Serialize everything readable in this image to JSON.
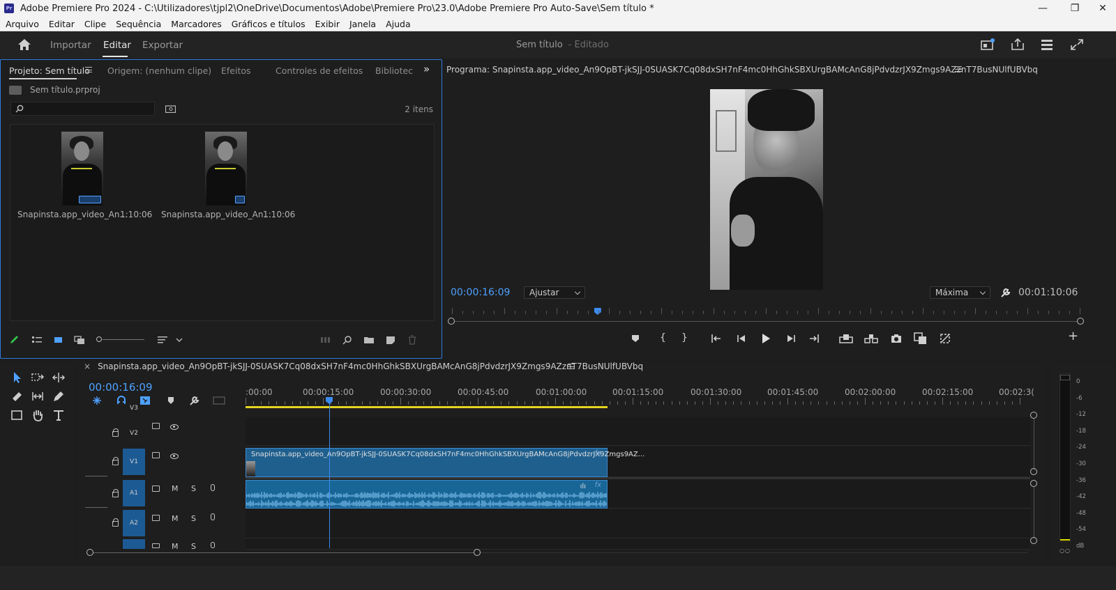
{
  "window": {
    "title": "Adobe Premiere Pro 2024 - C:\\Utilizadores\\tjpl2\\OneDrive\\Documentos\\Adobe\\Premiere Pro\\23.0\\Adobe Premiere Pro Auto-Save\\Sem título *",
    "logo_text": "Pr",
    "minimize": "—",
    "restore": "❐",
    "close": "✕"
  },
  "menu": [
    "Arquivo",
    "Editar",
    "Clipe",
    "Sequência",
    "Marcadores",
    "Gráficos e títulos",
    "Exibir",
    "Janela",
    "Ajuda"
  ],
  "workspace": {
    "tabs": [
      "Importar",
      "Editar",
      "Exportar"
    ],
    "active_tab": "Editar",
    "doc_title": "Sem título",
    "doc_status": "- Editado"
  },
  "project_panel": {
    "tabs": [
      "Projeto: Sem título",
      "Origem: (nenhum clipe)",
      "Efeitos",
      "Controles de efeitos",
      "Bibliotec"
    ],
    "more": "»",
    "project_file": "Sem título.prproj",
    "search_placeholder": "",
    "item_count": "2 itens",
    "items": [
      {
        "name": "Snapinsta.app_video_An...",
        "duration": "1:10:06"
      },
      {
        "name": "Snapinsta.app_video_An...",
        "duration": "1:10:06"
      }
    ]
  },
  "program_monitor": {
    "title": "Programa: Snapinsta.app_video_An9OpBT-jkSJJ-0SUASK7Cq08dxSH7nF4mc0HhGhkSBXUrgBAMcAnG8jPdvdzrJX9Zmgs9AZznT7BusNUlfUBVbq",
    "current_time": "00:00:16:09",
    "fit": "Ajustar",
    "quality": "Máxima",
    "duration": "00:01:10:06",
    "playhead_fraction": 0.232
  },
  "timeline": {
    "sequence_name": "Snapinsta.app_video_An9OpBT-jkSJJ-0SUASK7Cq08dxSH7nF4mc0HhGhkSBXUrgBAMcAnG8jPdvdzrJX9Zmgs9AZznT7BusNUlfUBVbq",
    "close": "×",
    "current_time": "00:00:16:09",
    "ruler": [
      ":00:00",
      "00:00:15:00",
      "00:00:30:00",
      "00:00:45:00",
      "00:01:00:00",
      "00:01:15:00",
      "00:01:30:00",
      "00:01:45:00",
      "00:02:00:00",
      "00:02:15:00",
      "00:02:3("
    ],
    "tracks": {
      "v3": "V3",
      "v2": "V2",
      "v1": "V1",
      "a1": "A1",
      "a2": "A2",
      "m": "M",
      "s": "S"
    },
    "video_clip_name": "Snapinsta.app_video_An9OpBT-jkSJJ-0SUASK7Cq08dxSH7nF4mc0HhGhkSBXUrgBAMcAnG8jPdvdzrJX9Zmgs9AZ...",
    "fx": "fx"
  },
  "audio_meter": {
    "scale": [
      "0",
      "-6",
      "-12",
      "-18",
      "-24",
      "-30",
      "-36",
      "-42",
      "-48",
      "-54",
      "dB"
    ],
    "solo": "S S"
  },
  "colors": {
    "accent_blue": "#4ea1ff",
    "panel_focus_border": "#2d7de0",
    "clip_blue": "#1f5f8e",
    "work_area_yellow": "#e5d51e",
    "meter_yellow": "#dede00"
  }
}
